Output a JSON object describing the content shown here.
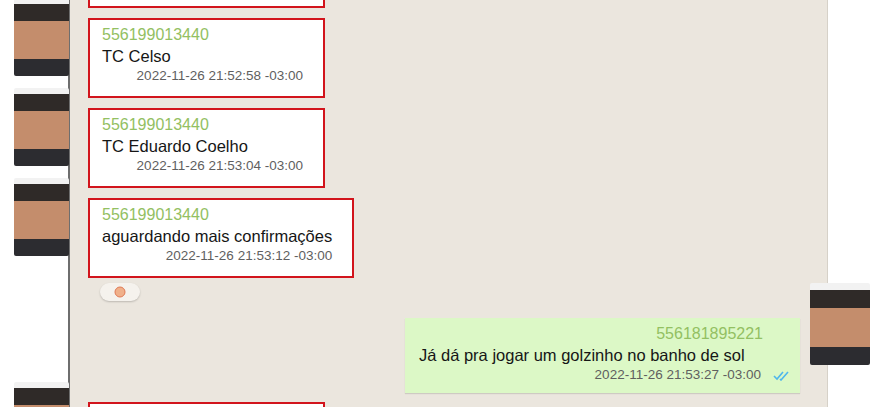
{
  "chat": {
    "messages": [
      {
        "kind": "cropped",
        "direction": "in",
        "highlighted": true
      },
      {
        "kind": "text",
        "direction": "in",
        "highlighted": true,
        "sender": "556199013440",
        "text": "TC Celso",
        "time": "2022-11-26 21:52:58 -03:00"
      },
      {
        "kind": "text",
        "direction": "in",
        "highlighted": true,
        "sender": "556199013440",
        "text": "TC Eduardo Coelho",
        "time": "2022-11-26 21:53:04 -03:00"
      },
      {
        "kind": "text",
        "direction": "in",
        "highlighted": true,
        "sender": "556199013440",
        "text": "aguardando mais confirmações",
        "time": "2022-11-26 21:53:12 -03:00"
      },
      {
        "kind": "reaction",
        "direction": "in"
      },
      {
        "kind": "text",
        "direction": "out",
        "highlighted": false,
        "sender": "556181895221",
        "text": "Já dá pra jogar um golzinho no banho de sol",
        "time": "2022-11-26 21:53:27 -03:00",
        "read": true
      },
      {
        "kind": "cropped",
        "direction": "in",
        "highlighted": true
      }
    ]
  }
}
